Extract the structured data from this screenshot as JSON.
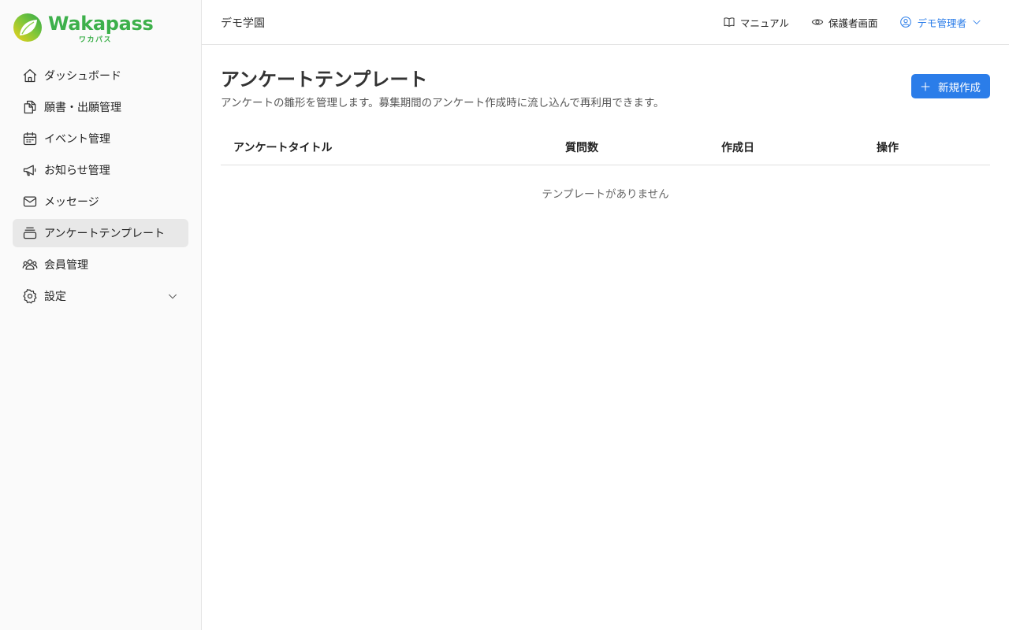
{
  "brand": {
    "name": "Wakapass",
    "kana": "ワカパス"
  },
  "sidebar": {
    "items": [
      {
        "label": "ダッシュボード",
        "icon": "home-icon"
      },
      {
        "label": "願書・出願管理",
        "icon": "documents-icon"
      },
      {
        "label": "イベント管理",
        "icon": "calendar-icon"
      },
      {
        "label": "お知らせ管理",
        "icon": "megaphone-icon"
      },
      {
        "label": "メッセージ",
        "icon": "mail-icon"
      },
      {
        "label": "アンケートテンプレート",
        "icon": "stack-icon",
        "active": true
      },
      {
        "label": "会員管理",
        "icon": "users-icon"
      },
      {
        "label": "設定",
        "icon": "gear-icon",
        "expandable": true
      }
    ]
  },
  "topbar": {
    "school": "デモ学園",
    "manual": "マニュアル",
    "guardian_view": "保護者画面",
    "user": "デモ管理者"
  },
  "main": {
    "title": "アンケートテンプレート",
    "description": "アンケートの雛形を管理します。募集期間のアンケート作成時に流し込んで再利用できます。",
    "new_button": "新規作成",
    "table": {
      "columns": [
        "アンケートタイトル",
        "質問数",
        "作成日",
        "操作"
      ],
      "empty": "テンプレートがありません"
    }
  },
  "colors": {
    "accent": "#2b7de9",
    "brand": "#3db04b"
  }
}
